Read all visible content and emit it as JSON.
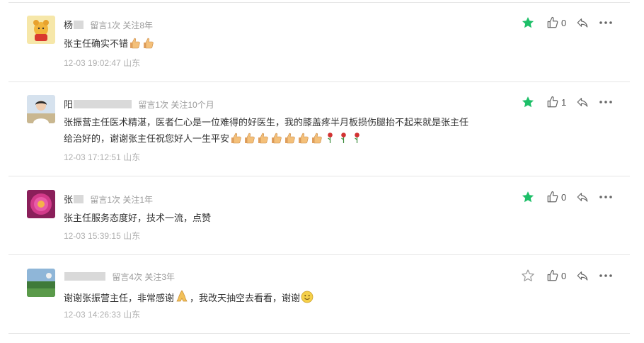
{
  "colors": {
    "star_active": "#1dbf68",
    "star_inactive": "#999999",
    "divider": "#e6e6e6"
  },
  "comments": [
    {
      "user": "杨",
      "stats": "留言1次 关注8年",
      "text": "张主任确实不错",
      "emojis": [
        "thumbs-up",
        "thumbs-up"
      ],
      "time": "12-03 19:02:47",
      "location": "山东",
      "likes": "0",
      "starred": true
    },
    {
      "user": "阳",
      "stats": "留言1次 关注10个月",
      "text_line1": "张振营主任医术精湛，医者仁心是一位难得的好医生，我的膝盖疼半月板损伤腿抬不起来就是张主任",
      "text_line2": "给治好的，谢谢张主任祝您好人一生平安",
      "emojis": [
        "thumbs-up",
        "thumbs-up",
        "thumbs-up",
        "thumbs-up",
        "thumbs-up",
        "thumbs-up",
        "thumbs-up",
        "rose",
        "rose",
        "rose"
      ],
      "time": "12-03 17:12:51",
      "location": "山东",
      "likes": "1",
      "starred": true
    },
    {
      "user": "张",
      "stats": "留言1次 关注1年",
      "text": "张主任服务态度好，技术一流，点赞",
      "time": "12-03 15:39:15",
      "location": "山东",
      "likes": "0",
      "starred": true
    },
    {
      "user": "",
      "stats": "留言4次 关注3年",
      "text_a": "谢谢张振营主任，非常感谢",
      "text_b": "，我改天抽空去看看，谢谢",
      "time": "12-03 14:26:33",
      "location": "山东",
      "likes": "0",
      "starred": false
    }
  ]
}
